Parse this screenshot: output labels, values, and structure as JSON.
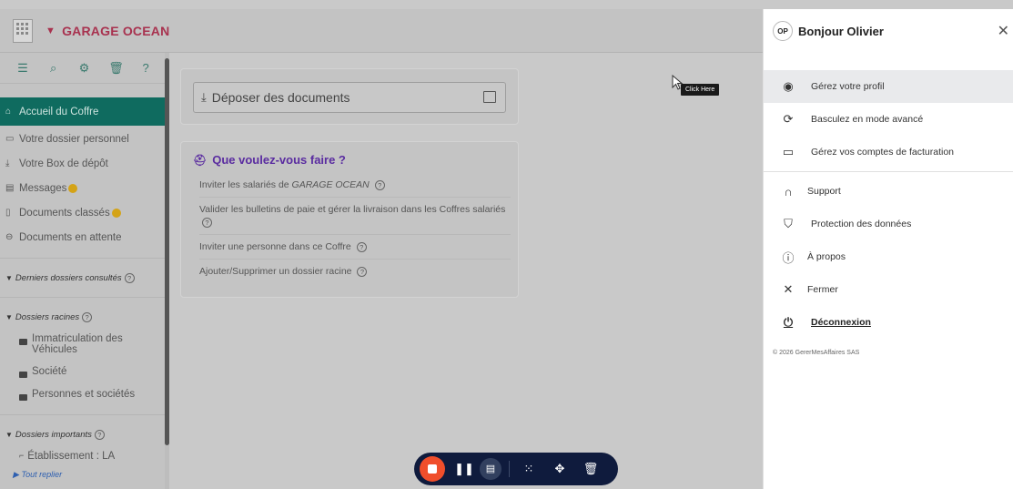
{
  "header": {
    "company_name": "GARAGE OCEAN"
  },
  "toolbar": {
    "icons": [
      "collapse-menu-icon",
      "search-icon",
      "settings-icon",
      "trash-icon",
      "help-icon"
    ]
  },
  "sidebar": {
    "nav": [
      {
        "label": "Accueil du Coffre",
        "icon": "home-icon",
        "active": true
      },
      {
        "label": "Votre dossier personnel",
        "icon": "briefcase-icon"
      },
      {
        "label": "Votre Box de dépôt",
        "icon": "download-icon"
      },
      {
        "label": "Messages",
        "icon": "message-icon",
        "badge": true
      },
      {
        "label": "Documents classés",
        "icon": "document-icon",
        "badge": true
      },
      {
        "label": "Documents en attente",
        "icon": "inbox-icon"
      }
    ],
    "recent_title": "Derniers dossiers consultés",
    "roots_title": "Dossiers racines",
    "roots": [
      "Immatriculation des Véhicules",
      "Société",
      "Personnes et sociétés"
    ],
    "important_title": "Dossiers importants",
    "important": [
      "Établissement : LA"
    ],
    "collapse_all": "Tout replier"
  },
  "main": {
    "upload_label": "Déposer des documents",
    "action_title": "Que voulez-vous faire ?",
    "actions": [
      {
        "prefix": "Inviter les salariés de ",
        "emph": "GARAGE OCEAN",
        "suffix": ""
      },
      {
        "prefix": "Valider les bulletins de paie et gérer la livraison dans les Coffres salariés",
        "emph": "",
        "suffix": ""
      },
      {
        "prefix": "Inviter une personne dans ce Coffre",
        "emph": "",
        "suffix": ""
      },
      {
        "prefix": "Ajouter/Supprimer un dossier racine",
        "emph": "",
        "suffix": ""
      }
    ],
    "tooltip": "Click Here"
  },
  "panel": {
    "initials": "OP",
    "greeting": "Bonjour Olivier",
    "menu": [
      {
        "label": "Gérez votre profil",
        "icon": "user-circle-icon",
        "active": true
      },
      {
        "label": "Basculez en mode avancé",
        "icon": "sync-icon"
      },
      {
        "label": "Gérez vos comptes de facturation",
        "icon": "credit-card-icon"
      }
    ],
    "menu2": [
      {
        "label": "Support",
        "icon": "headset-icon"
      },
      {
        "label": "Protection des données",
        "icon": "shield-check-icon"
      },
      {
        "label": "À propos",
        "icon": "info-icon"
      },
      {
        "label": "Fermer",
        "icon": "close-icon"
      },
      {
        "label": "Déconnexion",
        "icon": "power-icon"
      }
    ],
    "copyright": "© 2026 GererMesAffaires SAS"
  },
  "colors": {
    "brand": "#a8324f",
    "active_nav": "#0f6b5f",
    "action_title": "#5a2ca0",
    "recorder_bg": "#0f1b3d",
    "record_button": "#f04e2b"
  }
}
